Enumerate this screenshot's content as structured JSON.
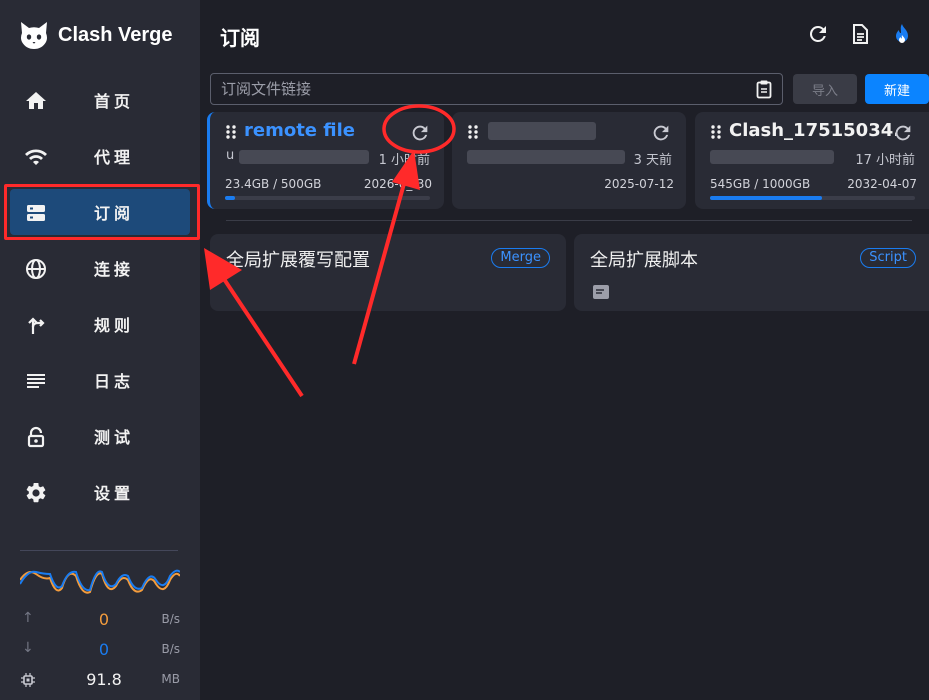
{
  "app": {
    "name": "Clash Verge"
  },
  "sidebar": {
    "items": [
      {
        "label": "首页",
        "icon": "home-icon"
      },
      {
        "label": "代理",
        "icon": "wifi-icon"
      },
      {
        "label": "订阅",
        "icon": "storage-icon",
        "active": true
      },
      {
        "label": "连接",
        "icon": "globe-icon"
      },
      {
        "label": "规则",
        "icon": "fork-icon"
      },
      {
        "label": "日志",
        "icon": "list-icon"
      },
      {
        "label": "测试",
        "icon": "lock-icon"
      },
      {
        "label": "设置",
        "icon": "gear-icon"
      }
    ],
    "traffic": {
      "upload_value": "0",
      "upload_unit": "B/s",
      "download_value": "0",
      "download_unit": "B/s",
      "memory_value": "91.8",
      "memory_unit": "MB"
    }
  },
  "header": {
    "title": "订阅",
    "icons": [
      "refresh-icon",
      "document-icon",
      "flame-icon"
    ]
  },
  "import_bar": {
    "placeholder": "订阅文件链接",
    "value": "",
    "import_label": "导入",
    "new_label": "新建"
  },
  "profiles": [
    {
      "title": "remote file",
      "line_prefix": "u",
      "updated": "1 小时前",
      "usage": "23.4GB / 500GB",
      "expire": "2026-0_-30",
      "usage_fraction": 0.047,
      "selected": true
    },
    {
      "title": "",
      "line_prefix": "",
      "updated": "3 天前",
      "usage": "",
      "expire": "2025-07-12",
      "usage_fraction": 0,
      "selected": false
    },
    {
      "title": "Clash_17515034...",
      "line_prefix": "",
      "updated": "17 小时前",
      "usage": "545GB / 1000GB",
      "expire": "2032-04-07",
      "usage_fraction": 0.545,
      "selected": false
    }
  ],
  "enhance": [
    {
      "title": "全局扩展覆写配置",
      "badge": "Merge"
    },
    {
      "title": "全局扩展脚本",
      "badge": "Script"
    }
  ],
  "colors": {
    "accent": "#1a7cf0",
    "sidebar_bg": "#292b35",
    "content_bg": "#1e1f27",
    "annotation": "#ff2a2a",
    "upload": "#f39c3d",
    "download": "#1a7cf0"
  }
}
